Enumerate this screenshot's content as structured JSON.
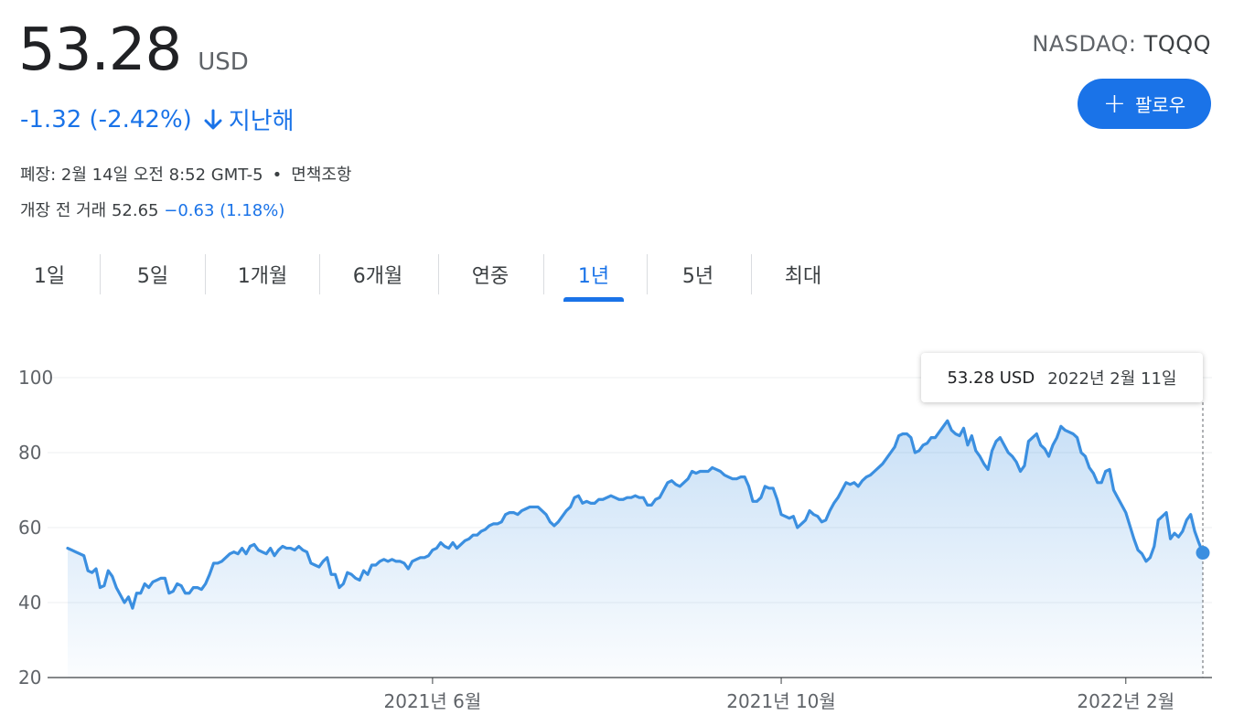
{
  "quote": {
    "price": "53.28",
    "currency": "USD",
    "change": "-1.32 (-2.42%)",
    "change_period": "지난해",
    "close_info": "폐장: 2월 14일 오전 8:52 GMT-5",
    "disclaimer": "면책조항",
    "premarket_label": "개장 전 거래 52.65",
    "premarket_change": "−0.63 (1.18%)",
    "exchange": "NASDAQ:",
    "ticker": "TQQQ"
  },
  "follow_button": {
    "label": "팔로우",
    "icon": "plus-icon"
  },
  "tabs": [
    {
      "label": "1일"
    },
    {
      "label": "5일"
    },
    {
      "label": "1개월"
    },
    {
      "label": "6개월"
    },
    {
      "label": "연중"
    },
    {
      "label": "1년",
      "active": true
    },
    {
      "label": "5년"
    },
    {
      "label": "최대"
    }
  ],
  "tooltip": {
    "value": "53.28 USD",
    "date": "2022년 2월 11일"
  },
  "colors": {
    "accent": "#1a73e8",
    "line": "#3b8fe0",
    "negative": "#1a73e8"
  },
  "chart_data": {
    "type": "area",
    "ylim": [
      20,
      100
    ],
    "yticks": [
      20,
      40,
      60,
      80,
      100
    ],
    "xticks": [
      {
        "label": "2021년 6월",
        "index": 90
      },
      {
        "label": "2021년 10월",
        "index": 176
      },
      {
        "label": "2022년 2월",
        "index": 261
      }
    ],
    "grid": true,
    "values": [
      54.5,
      54,
      53.5,
      53,
      52.5,
      48.5,
      48,
      49,
      44,
      44.5,
      48.5,
      47,
      44,
      42,
      40,
      41.5,
      38.5,
      42.5,
      42.5,
      45,
      44,
      45.5,
      46,
      46.5,
      46.5,
      42.5,
      43,
      45,
      44.5,
      42.5,
      42.5,
      44,
      44,
      43.5,
      45,
      47.5,
      50.5,
      50.5,
      51,
      52,
      53,
      53.5,
      53,
      54.5,
      53,
      55,
      55.5,
      54,
      53.5,
      53,
      54.5,
      52.5,
      54,
      55,
      54.5,
      54.5,
      54,
      55,
      54,
      53.5,
      50.5,
      50,
      49.5,
      51,
      52,
      47.5,
      47.5,
      44,
      45,
      48,
      47.5,
      46.5,
      46,
      48.5,
      47.5,
      50,
      50,
      51,
      51.5,
      51,
      51.5,
      51,
      51,
      50.5,
      49,
      51,
      51.5,
      52,
      52,
      52.5,
      54,
      54.5,
      56,
      55,
      54.5,
      56,
      54.5,
      55.5,
      56.5,
      57,
      58,
      58,
      59,
      59.5,
      60.5,
      61,
      61,
      61.5,
      63.5,
      64,
      64,
      63.5,
      64.5,
      65,
      65.5,
      65.5,
      65.5,
      64.5,
      63.5,
      61.5,
      60.5,
      61.5,
      63,
      64.5,
      65.5,
      68,
      68.5,
      66.5,
      67,
      66.5,
      66.5,
      67.5,
      67.5,
      68,
      68.5,
      68,
      67.5,
      67.5,
      68,
      68,
      68.5,
      68,
      68,
      66,
      66,
      67.5,
      68,
      70,
      72,
      72.5,
      71.5,
      71,
      72,
      73,
      75,
      74.5,
      75,
      75,
      75,
      76,
      75.5,
      75,
      74,
      73.5,
      73,
      73,
      73.5,
      73.5,
      71,
      67,
      67,
      68,
      71,
      70.5,
      70.5,
      67.5,
      63.5,
      63,
      62.5,
      63,
      60,
      61,
      62,
      64.5,
      63.5,
      63,
      61.5,
      62,
      64.5,
      66.5,
      68,
      70,
      72,
      71.5,
      72,
      71,
      72.5,
      73.5,
      74,
      75,
      76,
      77,
      78.5,
      80,
      81.5,
      84.5,
      85,
      85,
      84,
      80,
      80.5,
      82,
      82.5,
      84,
      84,
      85.5,
      87,
      88.5,
      86,
      85,
      84.5,
      86.5,
      82,
      84.5,
      80.5,
      79,
      77,
      75.5,
      80.5,
      83,
      84,
      82,
      80,
      79,
      77.5,
      75,
      76.5,
      83,
      84,
      85,
      82,
      81,
      79,
      82,
      84,
      87,
      86,
      85.5,
      85,
      84,
      80,
      79,
      76,
      74.5,
      72,
      72,
      75,
      75.5,
      70,
      68,
      66,
      64,
      60.5,
      57,
      54,
      53,
      51,
      52,
      55,
      62,
      63,
      64,
      57,
      58.5,
      57.5,
      59,
      62,
      63.5,
      59,
      56,
      53.28
    ]
  }
}
